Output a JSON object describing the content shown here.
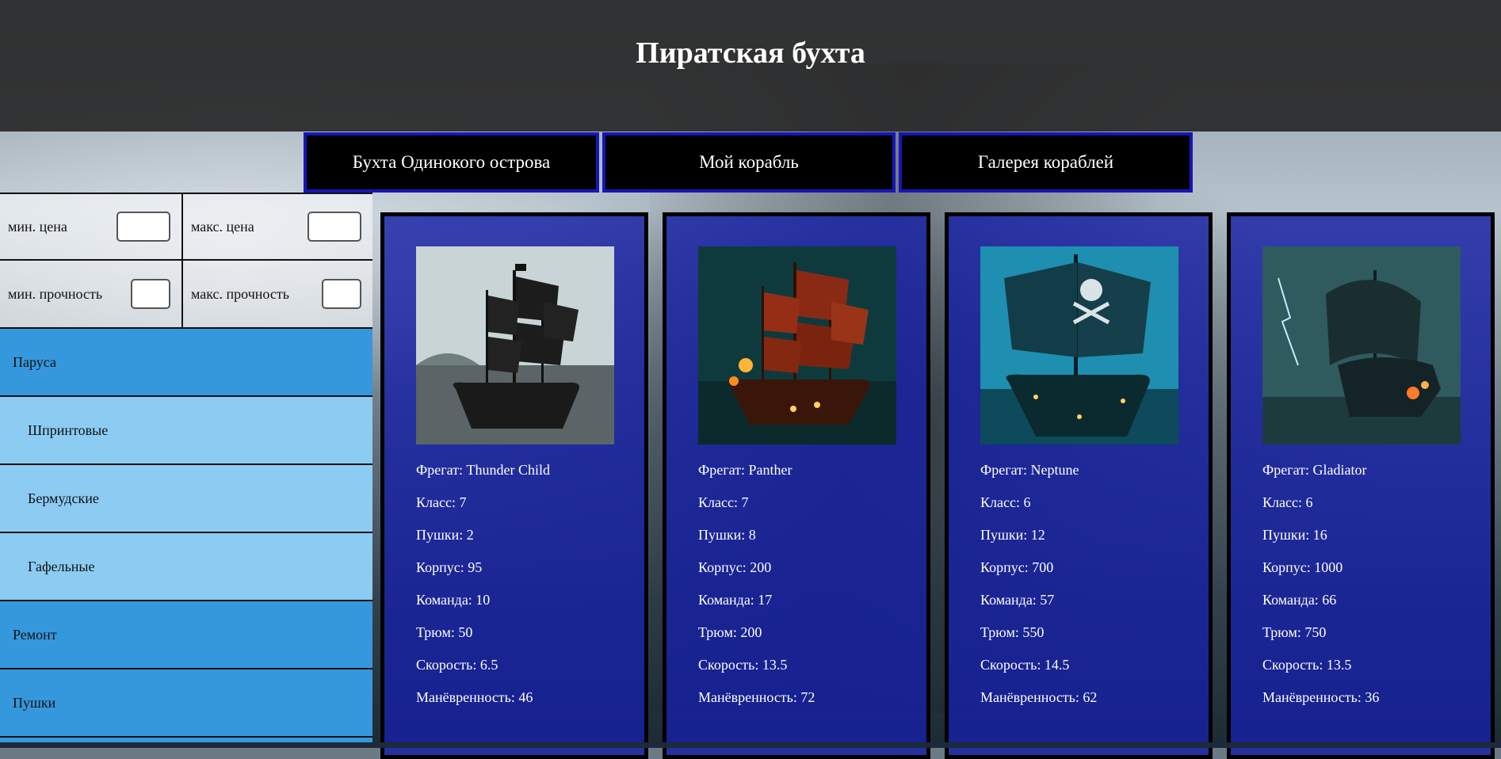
{
  "header": {
    "title": "Пиратская бухта"
  },
  "nav": {
    "tabs": [
      {
        "label": "Бухта Одинокого острова"
      },
      {
        "label": "Мой корабль"
      },
      {
        "label": "Галерея кораблей"
      }
    ]
  },
  "filters": {
    "min_price": {
      "label": "мин. цена",
      "value": ""
    },
    "max_price": {
      "label": "макс. цена",
      "value": ""
    },
    "min_strength": {
      "label": "мин. прочность",
      "value": ""
    },
    "max_strength": {
      "label": "макс. прочность",
      "value": ""
    }
  },
  "sidebar": {
    "items": [
      {
        "label": "Паруса",
        "level": "category"
      },
      {
        "label": "Шпринтовые",
        "level": "sub"
      },
      {
        "label": "Бермудские",
        "level": "sub"
      },
      {
        "label": "Гафельные",
        "level": "sub"
      },
      {
        "label": "Ремонт",
        "level": "category"
      },
      {
        "label": "Пушки",
        "level": "category"
      }
    ]
  },
  "ships": [
    {
      "frigate": "Фрегат: Thunder Child",
      "klass": "Класс: 7",
      "guns": "Пушки: 2",
      "hull": "Корпус: 95",
      "crew": "Команда: 10",
      "hold": "Трюм: 50",
      "speed": "Скорость: 6.5",
      "maneuver": "Манёвренность: 46",
      "image": "ship-thunder-child-image",
      "palette": {
        "sky": "#c9d4d6",
        "sea": "#3f4a4d",
        "sail": "#1c1c1c"
      }
    },
    {
      "frigate": "Фрегат: Panther",
      "klass": "Класс: 7",
      "guns": "Пушки: 8",
      "hull": "Корпус: 200",
      "crew": "Команда: 17",
      "hold": "Трюм: 200",
      "speed": "Скорость: 13.5",
      "maneuver": "Манёвренность: 72",
      "image": "ship-panther-image",
      "palette": {
        "sky": "#0f3a3d",
        "sea": "#123234",
        "sail": "#8a2a14"
      }
    },
    {
      "frigate": "Фрегат: Neptune",
      "klass": "Класс: 6",
      "guns": "Пушки: 12",
      "hull": "Корпус: 700",
      "crew": "Команда: 57",
      "hold": "Трюм: 550",
      "speed": "Скорость: 14.5",
      "maneuver": "Манёвренность: 62",
      "image": "ship-neptune-image",
      "palette": {
        "sky": "#1e8fb0",
        "sea": "#0d4a5c",
        "sail": "#123c48"
      }
    },
    {
      "frigate": "Фрегат: Gladiator",
      "klass": "Класс: 6",
      "guns": "Пушки: 16",
      "hull": "Корпус: 1000",
      "crew": "Команда: 66",
      "hold": "Трюм: 750",
      "speed": "Скорость: 13.5",
      "maneuver": "Манёвренность: 36",
      "image": "ship-gladiator-image",
      "palette": {
        "sky": "#2f5a5e",
        "sea": "#1d3a3d",
        "sail": "#1a2e30"
      }
    }
  ],
  "colors": {
    "nav_border": "#1616b8",
    "card_bg": "#1620a5",
    "category_bg": "#3598dd",
    "subcategory_bg": "#8ccbf2"
  }
}
